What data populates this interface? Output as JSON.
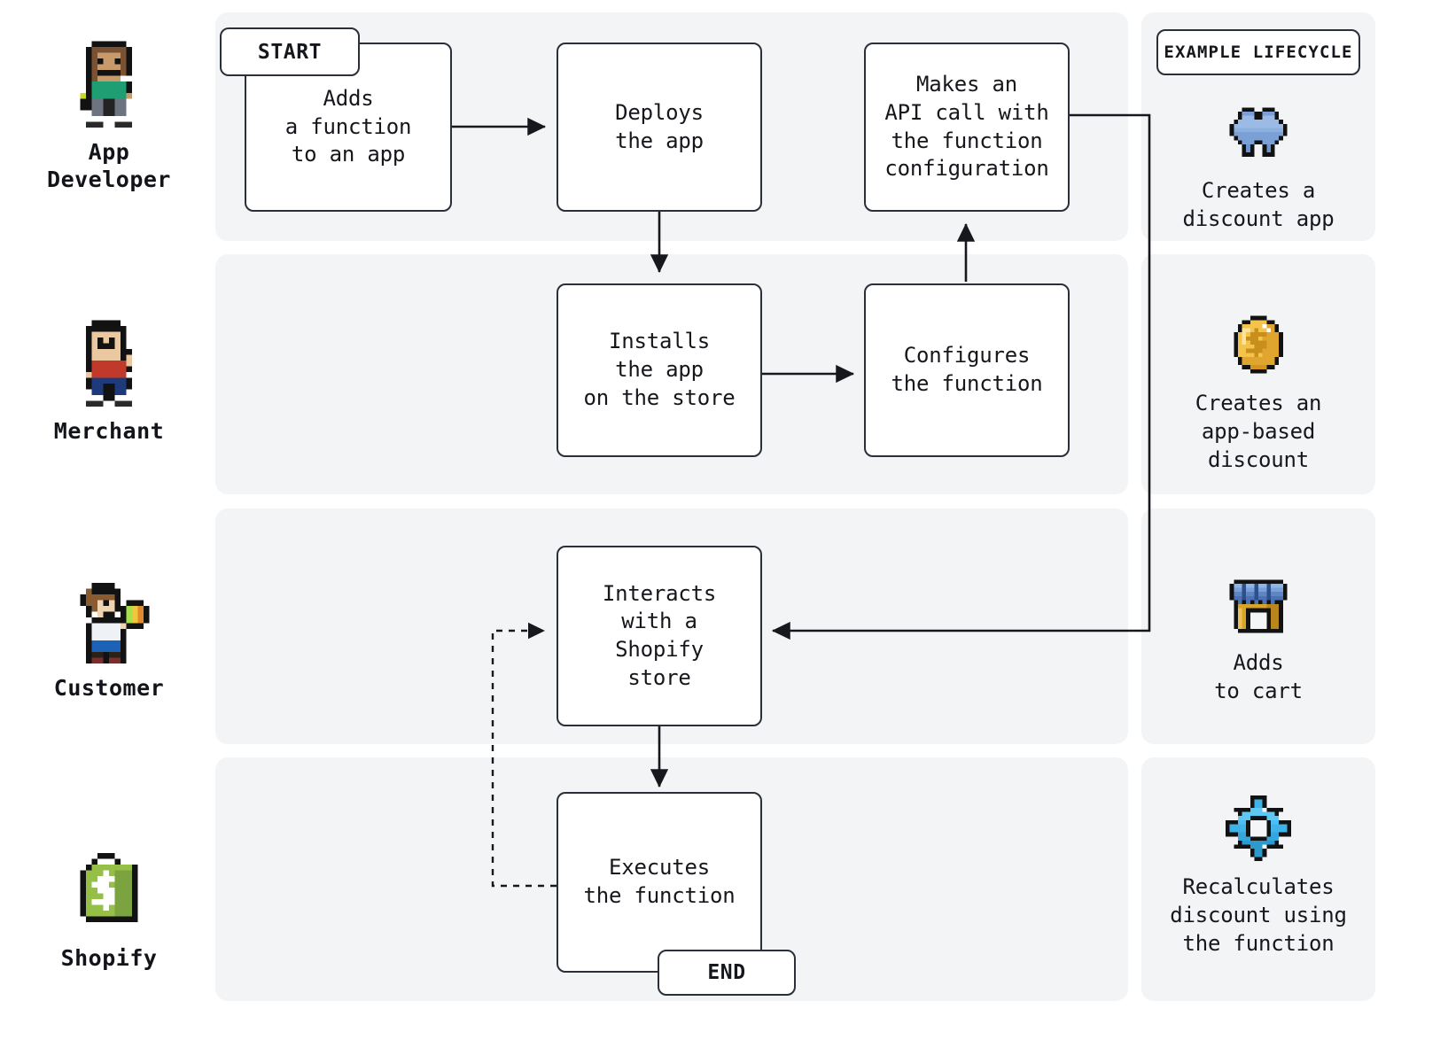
{
  "diagram": {
    "title": "Shopify function lifecycle swimlane",
    "colors": {
      "lane_background": "#f3f4f6",
      "node_border": "#2a2f3a",
      "node_fill": "#ffffff",
      "text": "#15171c",
      "page_background": "#ffffff"
    }
  },
  "actors": [
    {
      "id": "app-developer",
      "label": "App\nDeveloper",
      "sprite": "pixel-developer-avatar"
    },
    {
      "id": "merchant",
      "label": "Merchant",
      "sprite": "pixel-merchant-avatar"
    },
    {
      "id": "customer",
      "label": "Customer",
      "sprite": "pixel-customer-avatar"
    },
    {
      "id": "shopify",
      "label": "Shopify",
      "sprite": "shopify-bag-logo"
    }
  ],
  "terminals": {
    "start": "START",
    "end": "END"
  },
  "nodes": [
    {
      "id": "adds-function",
      "lane": "app-developer",
      "text": "Adds\na function\nto an app"
    },
    {
      "id": "deploys-app",
      "lane": "app-developer",
      "text": "Deploys\nthe app"
    },
    {
      "id": "makes-api-call",
      "lane": "app-developer",
      "text": "Makes an\nAPI call with\nthe function\nconfiguration"
    },
    {
      "id": "installs-app",
      "lane": "merchant",
      "text": "Installs\nthe app\non the store"
    },
    {
      "id": "configures-fn",
      "lane": "merchant",
      "text": "Configures\nthe function"
    },
    {
      "id": "interacts-store",
      "lane": "customer",
      "text": "Interacts\nwith a\nShopify\nstore"
    },
    {
      "id": "executes-fn",
      "lane": "shopify",
      "text": "Executes\nthe function"
    }
  ],
  "edges": [
    {
      "from": "adds-function",
      "to": "deploys-app",
      "style": "solid"
    },
    {
      "from": "deploys-app",
      "to": "installs-app",
      "style": "solid"
    },
    {
      "from": "installs-app",
      "to": "configures-fn",
      "style": "solid"
    },
    {
      "from": "configures-fn",
      "to": "makes-api-call",
      "style": "solid"
    },
    {
      "from": "makes-api-call",
      "to": "interacts-store",
      "style": "solid"
    },
    {
      "from": "interacts-store",
      "to": "executes-fn",
      "style": "solid"
    },
    {
      "from": "executes-fn",
      "to": "interacts-store",
      "style": "dashed"
    }
  ],
  "legend": {
    "badge": "EXAMPLE LIFECYCLE",
    "items": [
      {
        "id": "creates-discount-app",
        "icon": "puzzle-piece-icon",
        "text": "Creates a\ndiscount app"
      },
      {
        "id": "creates-app-discount",
        "icon": "gold-coin-icon",
        "text": "Creates an\napp-based\ndiscount"
      },
      {
        "id": "adds-to-cart",
        "icon": "storefront-icon",
        "text": "Adds\nto cart"
      },
      {
        "id": "recalculates-discount",
        "icon": "gear-icon",
        "text": "Recalculates\ndiscount using\nthe function"
      }
    ]
  }
}
